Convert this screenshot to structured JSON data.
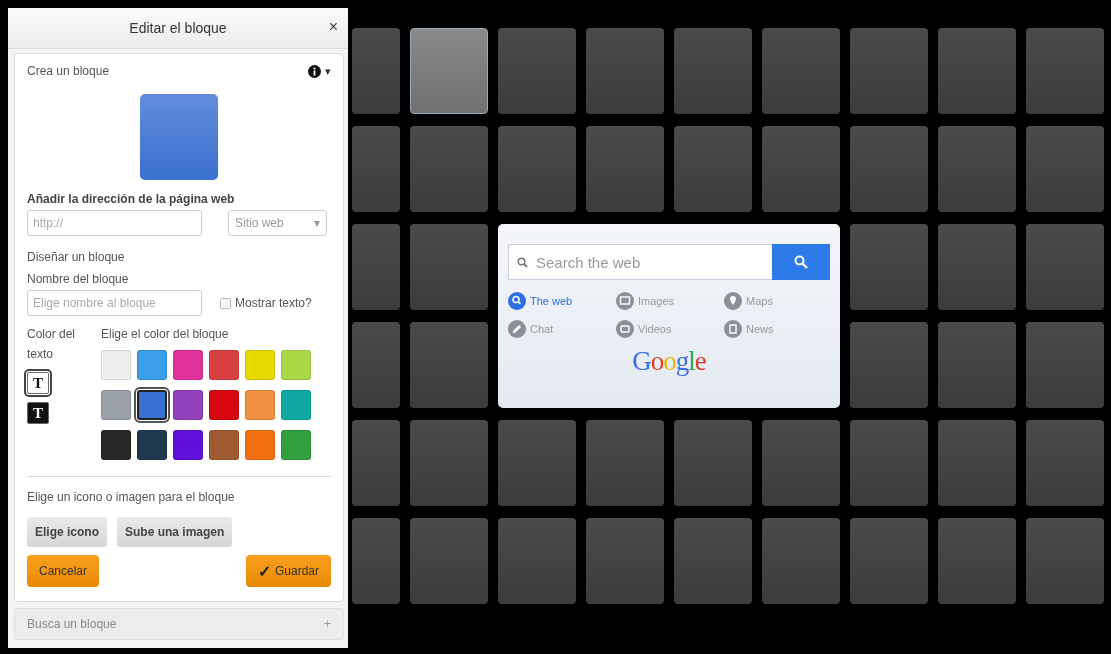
{
  "panel": {
    "title": "Editar el bloque",
    "close": "×",
    "section": {
      "title": "Crea un bloque",
      "toggle": "▾"
    },
    "url_label": "Añadir la dirección de la página web",
    "url_field": {
      "placeholder": "http://"
    },
    "type_select": {
      "value": "Sitio web",
      "caret": "▾"
    },
    "design_label": "Diseñar un bloque",
    "name_label": "Nombre del bloque",
    "name_field": {
      "placeholder": "Elige nombre al bloque"
    },
    "show_text": {
      "label": "Mostrar texto?",
      "checked": false
    },
    "text_color_label": "Color del texto",
    "text_colors": [
      {
        "label": "T",
        "color": "#ffffff",
        "selected": true
      },
      {
        "label": "T",
        "color": "#111111",
        "selected": false
      }
    ],
    "block_color_label": "Elige el color del bloque",
    "swatches": [
      {
        "color": "#eeeeee",
        "selected": false
      },
      {
        "color": "#3a9ee8",
        "selected": false
      },
      {
        "color": "#e0309a",
        "selected": false
      },
      {
        "color": "#d84040",
        "selected": false
      },
      {
        "color": "#e8d800",
        "selected": false
      },
      {
        "color": "#a8d848",
        "selected": false
      },
      {
        "color": "#9aa0a8",
        "selected": false
      },
      {
        "color": "#3a70d0",
        "selected": true
      },
      {
        "color": "#9040b8",
        "selected": false
      },
      {
        "color": "#d80810",
        "selected": false
      },
      {
        "color": "#f09040",
        "selected": false
      },
      {
        "color": "#10a8a0",
        "selected": false
      },
      {
        "color": "#282828",
        "selected": false
      },
      {
        "color": "#203850",
        "selected": false
      },
      {
        "color": "#6010d8",
        "selected": false
      },
      {
        "color": "#a05a30",
        "selected": false
      },
      {
        "color": "#f07010",
        "selected": false
      },
      {
        "color": "#30a040",
        "selected": false
      }
    ],
    "icon_label": "Elige un icono o imagen para el bloque",
    "icon_buttons": [
      "Elige icono",
      "Sube una imagen"
    ],
    "cancel": "Cancelar",
    "save": {
      "icon": "✓",
      "label": "Guardar"
    },
    "collapsed_sections": [
      {
        "title": "Busca un bloque",
        "toggle": "+"
      }
    ]
  },
  "tiles": [
    {
      "selected": false
    },
    {
      "selected": true
    },
    {
      "selected": false
    },
    {
      "selected": false
    },
    {
      "selected": false
    },
    {
      "selected": false
    },
    {
      "selected": false
    },
    {
      "selected": false
    },
    {
      "selected": false
    },
    {
      "selected": false
    },
    {
      "selected": false
    },
    {
      "selected": false
    },
    {
      "selected": false
    },
    {
      "selected": false
    },
    {
      "selected": false
    },
    {
      "selected": false
    },
    {
      "selected": false
    },
    {
      "selected": false
    },
    {
      "selected": false
    },
    {
      "selected": false
    },
    {
      "selected": false
    },
    {
      "selected": false
    },
    {
      "selected": false
    },
    {
      "selected": false
    },
    {
      "selected": false
    },
    {
      "selected": false
    },
    {
      "selected": false
    },
    {
      "selected": false
    },
    {
      "selected": false
    },
    {
      "selected": false
    },
    {
      "selected": false
    },
    {
      "selected": false
    },
    {
      "selected": false
    },
    {
      "selected": false
    },
    {
      "selected": false
    },
    {
      "selected": false
    },
    {
      "selected": false
    },
    {
      "selected": false
    },
    {
      "selected": false
    },
    {
      "selected": false
    },
    {
      "selected": false
    },
    {
      "selected": false
    },
    {
      "selected": false
    },
    {
      "selected": false
    },
    {
      "selected": false
    },
    {
      "selected": false
    }
  ],
  "search_widget": {
    "placeholder": "Search the web",
    "links": [
      {
        "label": "The web",
        "selected": true
      },
      {
        "label": "Images",
        "selected": false
      },
      {
        "label": "Maps",
        "selected": false
      },
      {
        "label": "Chat",
        "selected": false
      },
      {
        "label": "Videos",
        "selected": false
      },
      {
        "label": "News",
        "selected": false
      }
    ],
    "logo": "Google"
  }
}
